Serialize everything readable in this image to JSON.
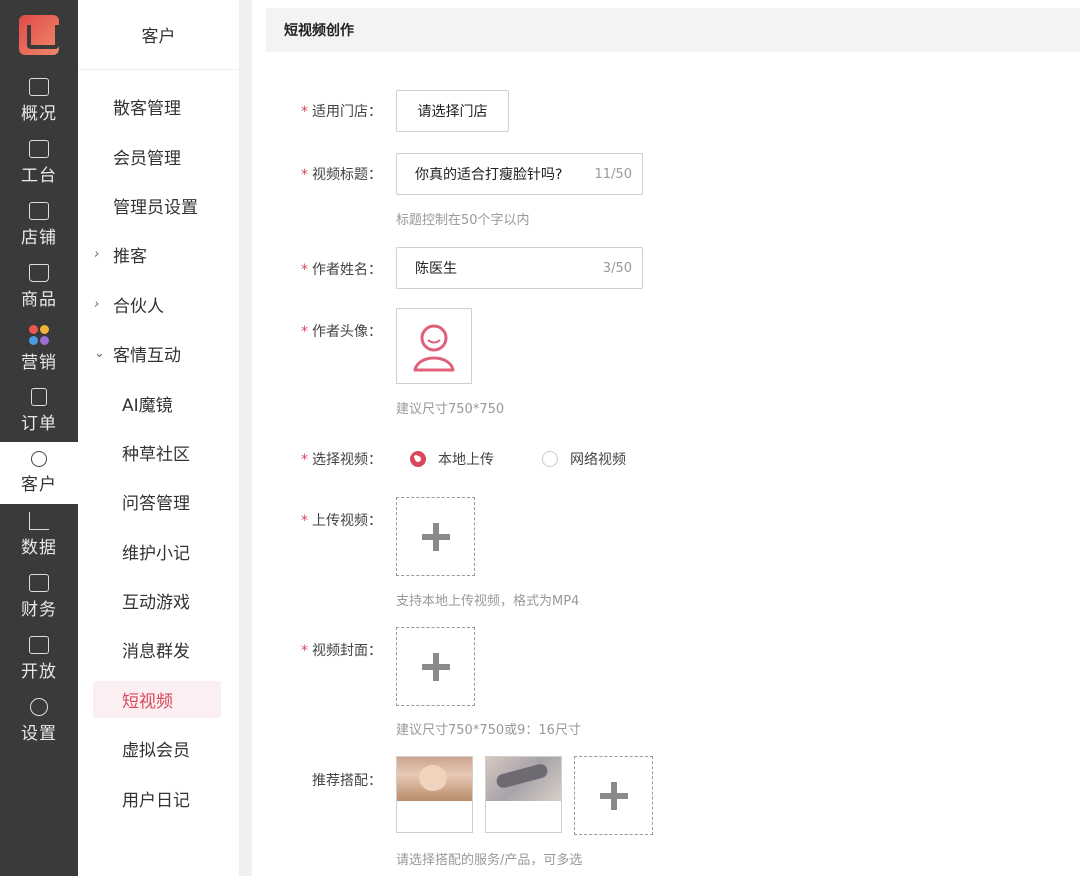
{
  "rail": {
    "items": [
      {
        "label": "概况",
        "icon": "monitor-icon"
      },
      {
        "label": "工台",
        "icon": "desktop-icon"
      },
      {
        "label": "店铺",
        "icon": "store-icon"
      },
      {
        "label": "商品",
        "icon": "bag-icon"
      },
      {
        "label": "营销",
        "icon": "petals-icon"
      },
      {
        "label": "订单",
        "icon": "receipt-icon"
      },
      {
        "label": "客户",
        "icon": "user-icon"
      },
      {
        "label": "数据",
        "icon": "chart-icon"
      },
      {
        "label": "财务",
        "icon": "finance-icon"
      },
      {
        "label": "开放",
        "icon": "code-icon"
      },
      {
        "label": "设置",
        "icon": "gear-icon"
      }
    ],
    "active_label": "客户"
  },
  "submenu": {
    "title": "客户",
    "items": [
      {
        "label": "散客管理"
      },
      {
        "label": "会员管理"
      },
      {
        "label": "管理员设置"
      },
      {
        "label": "推客",
        "caret": "›"
      },
      {
        "label": "合伙人",
        "caret": "›"
      },
      {
        "label": "客情互动",
        "caret": "⌄"
      },
      {
        "label": "AI魔镜"
      },
      {
        "label": "种草社区"
      },
      {
        "label": "问答管理"
      },
      {
        "label": "维护小记"
      },
      {
        "label": "互动游戏"
      },
      {
        "label": "消息群发"
      },
      {
        "label": "短视频"
      },
      {
        "label": "虚拟会员"
      },
      {
        "label": "用户日记"
      }
    ],
    "active_label": "短视频"
  },
  "page": {
    "title": "短视频创作",
    "store": {
      "label": "适用门店：",
      "button": "请选择门店"
    },
    "video_title": {
      "label": "视频标题：",
      "value": "你真的适合打瘦脸针吗?",
      "count": "11/50",
      "hint": "标题控制在50个字以内"
    },
    "author_name": {
      "label": "作者姓名：",
      "value": "陈医生",
      "count": "3/50"
    },
    "author_avatar": {
      "label": "作者头像：",
      "hint": "建议尺寸750*750"
    },
    "select_video": {
      "label": "选择视频：",
      "options": [
        "本地上传",
        "网络视频"
      ],
      "selected": "本地上传"
    },
    "upload_video": {
      "label": "上传视频：",
      "hint": "支持本地上传视频，格式为MP4"
    },
    "cover": {
      "label": "视频封面：",
      "hint": "建议尺寸750*750或9：16尺寸"
    },
    "recommend": {
      "label": "推荐搭配：",
      "hint": "请选择搭配的服务/产品，可多选"
    },
    "required_mark": "*",
    "accent": "#d9485a"
  }
}
